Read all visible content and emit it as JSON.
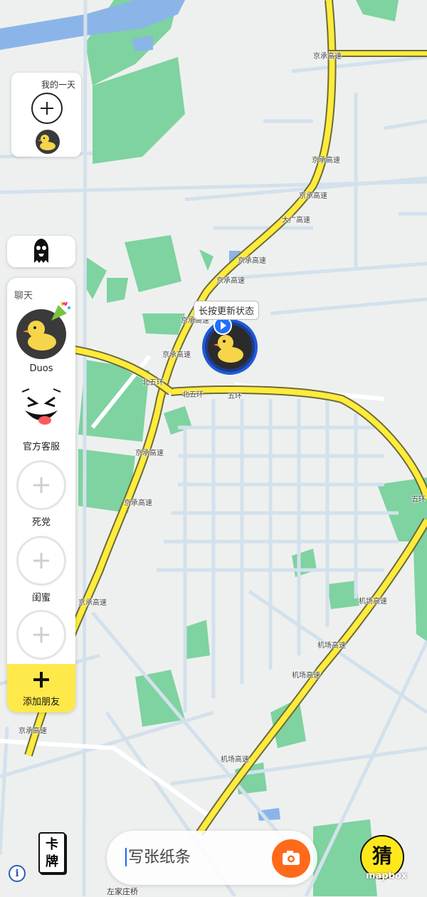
{
  "map": {
    "road_labels": [
      {
        "text": "京承高速"
      },
      {
        "text": "京承高速"
      },
      {
        "text": "京承高速"
      },
      {
        "text": "大广高速"
      },
      {
        "text": "京承高速"
      },
      {
        "text": "京承高速"
      },
      {
        "text": "京承高速"
      },
      {
        "text": "北五环"
      },
      {
        "text": "北五环"
      },
      {
        "text": "五环"
      },
      {
        "text": "京承高速"
      },
      {
        "text": "京承高速"
      },
      {
        "text": "京承高速"
      },
      {
        "text": "机场高速"
      },
      {
        "text": "机场高速"
      },
      {
        "text": "机场高速"
      },
      {
        "text": "京承高速"
      },
      {
        "text": "机场高速"
      },
      {
        "text": "五环"
      },
      {
        "text": "京承高速"
      }
    ],
    "place_label": "左家庄桥",
    "attribution": "mapbox"
  },
  "my_day": {
    "title": "我的一天",
    "add_icon": "plus-icon",
    "avatar": "duck-avatar"
  },
  "ghost_mode": {
    "icon": "ghost-icon"
  },
  "chat": {
    "title": "聊天",
    "contacts": [
      {
        "label": "Duos",
        "icon": "duck-avatar",
        "badge": "party-popper-icon"
      },
      {
        "label": "官方客服",
        "icon": "tongue-face-icon"
      },
      {
        "label": "死党",
        "icon": "plus-icon"
      },
      {
        "label": "闺蜜",
        "icon": "plus-icon"
      },
      {
        "label": "",
        "icon": "plus-icon"
      }
    ],
    "add_friend": {
      "label": "添加朋友",
      "icon": "plus-icon"
    }
  },
  "user_marker": {
    "tooltip": "长按更新状态",
    "icon": "duck-avatar"
  },
  "bottom_bar": {
    "cards_label": "卡牌",
    "info_icon": "info-icon",
    "note_placeholder": "写张纸条",
    "camera_icon": "camera-icon",
    "guess_label": "猜"
  },
  "colors": {
    "highway": "#ffeb3b",
    "highway_border": "#6b6a3a",
    "park": "#7ed3a0",
    "road": "#d6e3ee",
    "accent_yellow": "#ffe94a",
    "camera": "#ff6a1a",
    "marker_blue": "#1f5ad8"
  }
}
